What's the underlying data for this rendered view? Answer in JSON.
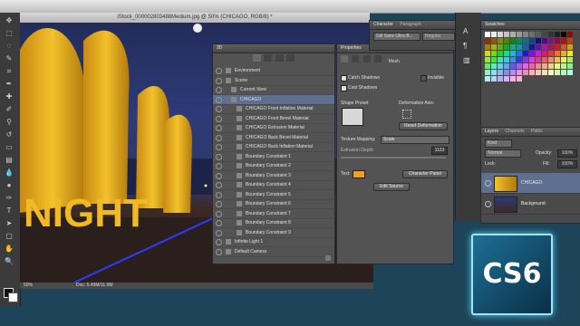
{
  "document": {
    "title": "iStock_000002803488Medium.jpg @ 50% (CHICAGO, RGB/8) *",
    "zoom": "50%",
    "doc_info": "Doc: 5.49M/11.9M",
    "canvas_word": "NIGHT"
  },
  "panel3d": {
    "tab": "3D",
    "items": [
      {
        "label": "Environment",
        "selected": false
      },
      {
        "label": "Scene",
        "selected": false
      },
      {
        "label": "Current View",
        "selected": false
      },
      {
        "label": "CHICAGO",
        "selected": true
      },
      {
        "label": "CHICAGO Front Inflation Material",
        "selected": false
      },
      {
        "label": "CHICAGO Front Bevel Material",
        "selected": false
      },
      {
        "label": "CHICAGO Extrusion Material",
        "selected": false
      },
      {
        "label": "CHICAGO Back Bevel Material",
        "selected": false
      },
      {
        "label": "CHICAGO Back Inflation Material",
        "selected": false
      },
      {
        "label": "Boundary Constraint 1",
        "selected": false
      },
      {
        "label": "Boundary Constraint 2",
        "selected": false
      },
      {
        "label": "Boundary Constraint 3",
        "selected": false
      },
      {
        "label": "Boundary Constraint 4",
        "selected": false
      },
      {
        "label": "Boundary Constraint 5",
        "selected": false
      },
      {
        "label": "Boundary Constraint 6",
        "selected": false
      },
      {
        "label": "Boundary Constraint 7",
        "selected": false
      },
      {
        "label": "Boundary Constraint 8",
        "selected": false
      },
      {
        "label": "Boundary Constraint 9",
        "selected": false
      },
      {
        "label": "Infinite Light 1",
        "selected": false
      },
      {
        "label": "Default Camera",
        "selected": false
      }
    ]
  },
  "properties": {
    "tab": "Properties",
    "mode_label": "Mesh",
    "catch_shadows": "Catch Shadows",
    "cast_shadows": "Cast Shadows",
    "invisible": "Invisible",
    "shape_preset": "Shape Preset",
    "deformation_axis": "Deformation Axis:",
    "reset_deformation": "Reset Deformation",
    "texture_mapping": "Texture Mapping:",
    "texture_value": "Scale",
    "extrusion_depth": "Extrusion Depth:",
    "depth_value": "1123",
    "text_label": "Text:",
    "character_panel": "Character Panel",
    "edit_source": "Edit Source"
  },
  "character": {
    "tab_character": "Character",
    "tab_paragraph": "Paragraph",
    "font": "Gill Sans Ultra B...",
    "style": "Regular"
  },
  "swatches": {
    "tab": "Swatches"
  },
  "layers": {
    "tab_layers": "Layers",
    "tab_channels": "Channels",
    "tab_paths": "Paths",
    "kind": "Kind",
    "blend_mode": "Normal",
    "opacity_label": "Opacity:",
    "opacity_value": "100%",
    "lock_label": "Lock:",
    "fill_label": "Fill:",
    "fill_value": "100%",
    "items": [
      {
        "name": "CHICAGO",
        "selected": true
      },
      {
        "name": "Background",
        "selected": false
      }
    ]
  },
  "badge": {
    "text": "CS6"
  },
  "colors": {
    "selection": "#5f6f90",
    "accent": "#f0a020",
    "panel": "#535353"
  }
}
